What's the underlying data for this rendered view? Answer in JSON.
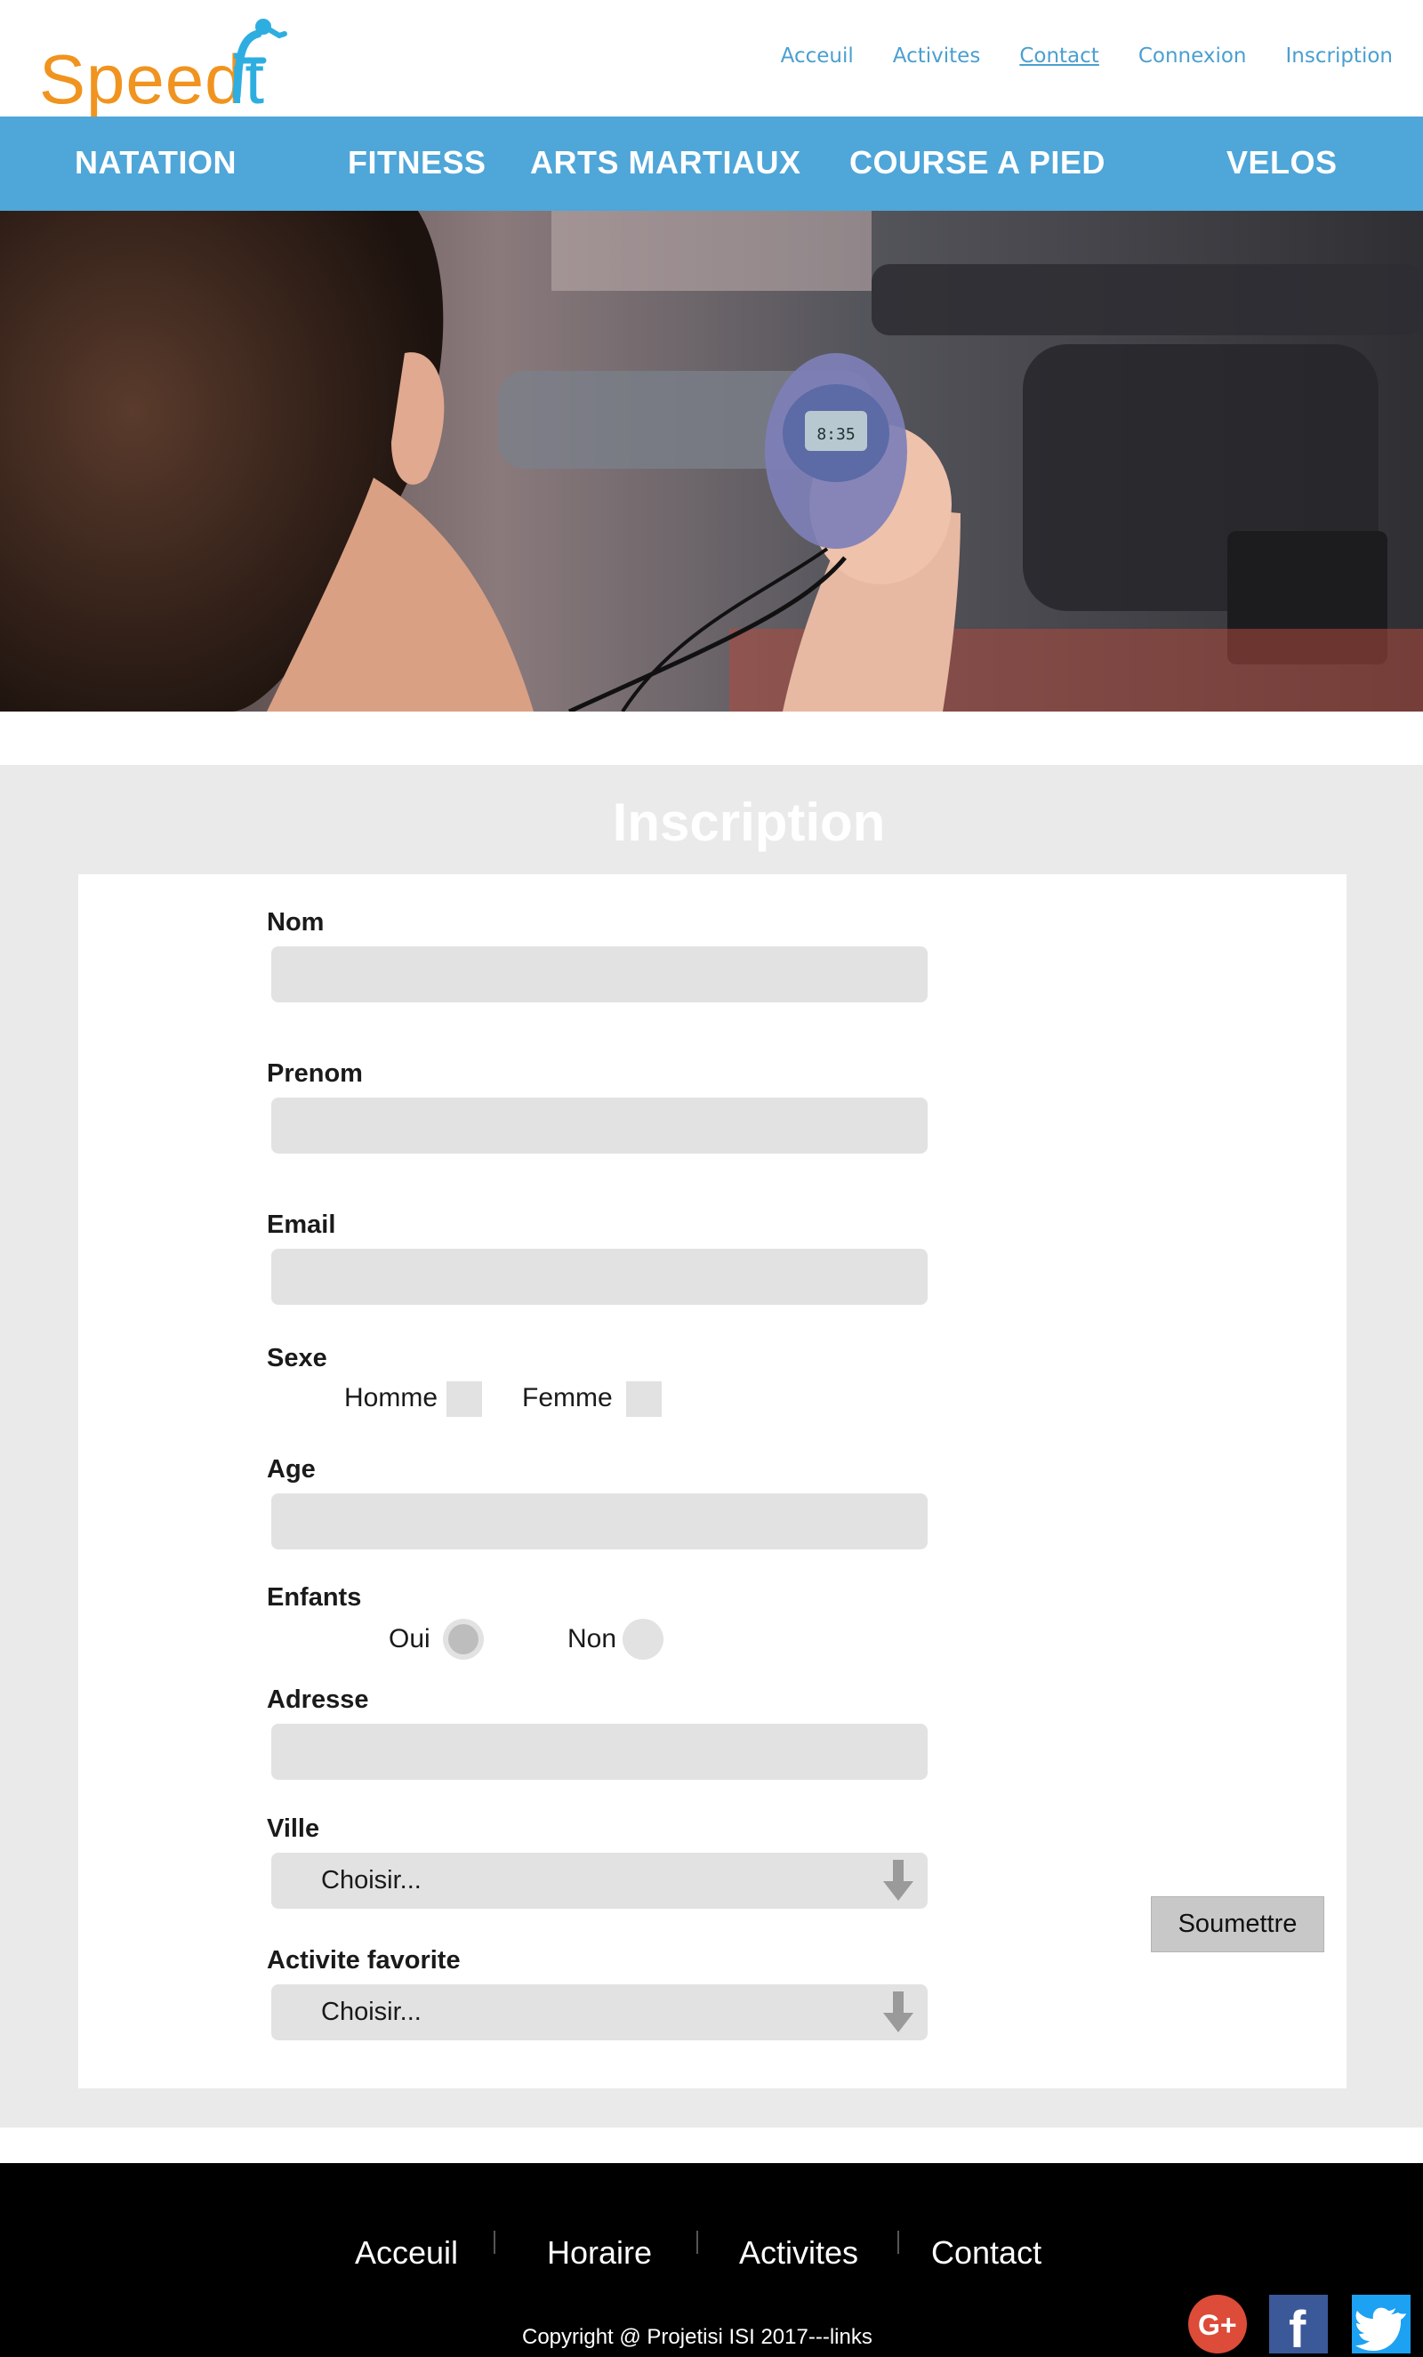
{
  "brand": {
    "name_part1": "Speed",
    "name_part2": "it"
  },
  "top_nav": [
    "Acceuil",
    "Activites",
    "Contact",
    "Connexion",
    "Inscription"
  ],
  "active_top_nav": "Contact",
  "categories": [
    "NATATION",
    "FITNESS",
    "ARTS MARTIAUX",
    "COURSE A PIED",
    "VELOS"
  ],
  "hero": {
    "subject": "woman holding stopwatch in gym"
  },
  "form": {
    "title": "Inscription",
    "fields": {
      "nom": {
        "label": "Nom",
        "value": ""
      },
      "prenom": {
        "label": "Prenom",
        "value": ""
      },
      "email": {
        "label": "Email",
        "value": ""
      },
      "age": {
        "label": "Age",
        "value": ""
      },
      "adresse": {
        "label": "Adresse",
        "value": ""
      }
    },
    "sexe": {
      "label": "Sexe",
      "options": [
        "Homme",
        "Femme"
      ],
      "checked": []
    },
    "enfants": {
      "label": "Enfants",
      "options": [
        "Oui",
        "Non"
      ],
      "selected": "Oui"
    },
    "ville": {
      "label": "Ville",
      "selected": "Choisir..."
    },
    "activite": {
      "label": "Activite favorite",
      "selected": "Choisir..."
    },
    "submit_label": "Soumettre"
  },
  "footer": {
    "nav": [
      "Acceuil",
      "Horaire",
      "Activites",
      "Contact"
    ],
    "copyright": "Copyright @ Projetisi ISI 2017---links",
    "social_icons": [
      "google-plus-icon",
      "facebook-icon",
      "twitter-icon"
    ]
  },
  "colors": {
    "accent_blue": "#4fa6d8",
    "brand_orange": "#f0941f",
    "brand_blue": "#2eaee0",
    "form_bg": "#eaeaea",
    "input_bg": "#e2e2e2",
    "footer_bg": "#000000"
  }
}
